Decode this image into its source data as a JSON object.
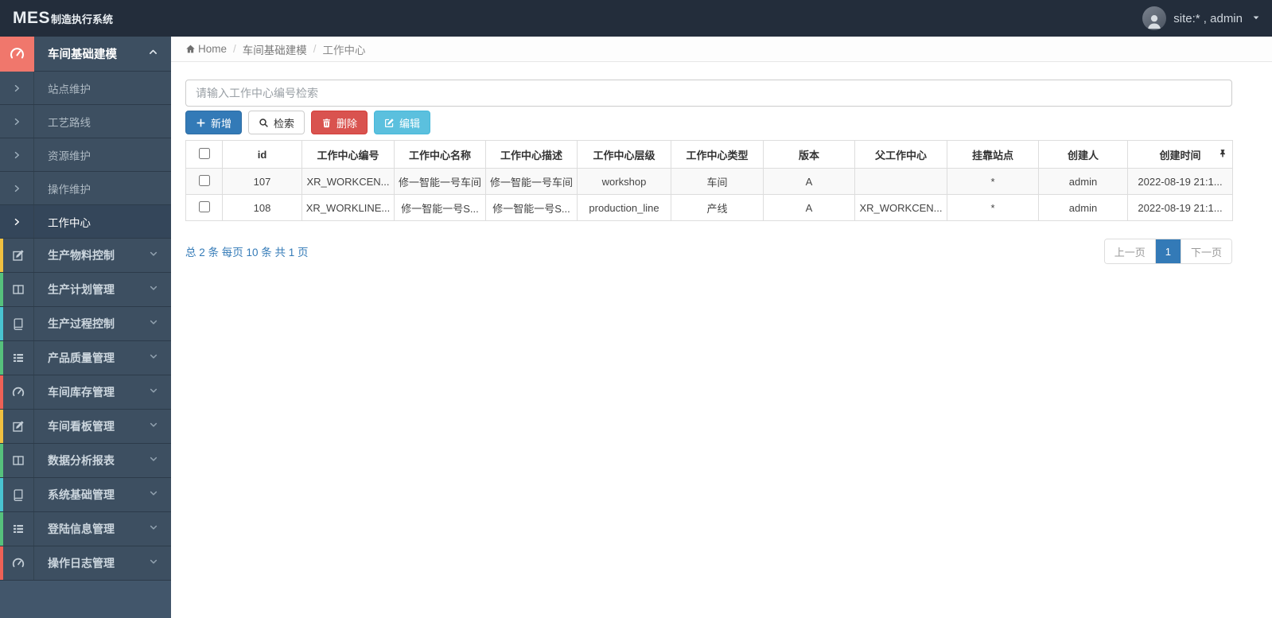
{
  "colors": {
    "topbar_bg": "#232d3b",
    "sidebar_bg": "#42566b",
    "sidebar_item_bg": "#3d4f61",
    "group_icon_bg": "#f0776c",
    "primary_blue": "#337ab7",
    "danger_red": "#d9534f",
    "info_blue": "#5bc0de",
    "accent_yellow": "#f0c040",
    "accent_green": "#56c17c",
    "accent_teal": "#49c3d0",
    "accent_red": "#ee6156"
  },
  "topbar": {
    "logo_main": "MES",
    "logo_suffix": "制造执行系统",
    "user_label": "site:* , admin"
  },
  "breadcrumb": {
    "home": "Home",
    "separator": "/",
    "section": "车间基础建模",
    "current": "工作中心"
  },
  "sidebar": {
    "group_label": "车间基础建模",
    "submenu": [
      {
        "label": "站点维护"
      },
      {
        "label": "工艺路线"
      },
      {
        "label": "资源维护"
      },
      {
        "label": "操作维护"
      },
      {
        "label": "工作中心",
        "active": true
      }
    ],
    "items": [
      {
        "label": "生产物料控制",
        "icon": "pencil-icon",
        "accent": "#f0c040"
      },
      {
        "label": "生产计划管理",
        "icon": "columns-icon",
        "accent": "#56c17c"
      },
      {
        "label": "生产过程控制",
        "icon": "book-icon",
        "accent": "#49c3d0"
      },
      {
        "label": "产品质量管理",
        "icon": "list-icon",
        "accent": "#56c17c"
      },
      {
        "label": "车间库存管理",
        "icon": "gauge-icon",
        "accent": "#ee6156"
      },
      {
        "label": "车间看板管理",
        "icon": "pencil-icon",
        "accent": "#f0c040"
      },
      {
        "label": "数据分析报表",
        "icon": "columns-icon",
        "accent": "#56c17c"
      },
      {
        "label": "系统基础管理",
        "icon": "book-icon",
        "accent": "#49c3d0"
      },
      {
        "label": "登陆信息管理",
        "icon": "list-icon",
        "accent": "#56c17c"
      },
      {
        "label": "操作日志管理",
        "icon": "gauge-icon",
        "accent": "#ee6156"
      }
    ]
  },
  "toolbar": {
    "search_placeholder": "请输入工作中心编号检索",
    "add_label": "新增",
    "search_label": "检索",
    "delete_label": "删除",
    "edit_label": "编辑"
  },
  "table": {
    "columns": [
      "id",
      "工作中心编号",
      "工作中心名称",
      "工作中心描述",
      "工作中心层级",
      "工作中心类型",
      "版本",
      "父工作中心",
      "挂靠站点",
      "创建人",
      "创建时间"
    ],
    "rows": [
      {
        "cells": [
          "107",
          "XR_WORKCEN...",
          "修一智能一号车间",
          "修一智能一号车间",
          "workshop",
          "车间",
          "A",
          "",
          "*",
          "admin",
          "2022-08-19 21:1..."
        ]
      },
      {
        "cells": [
          "108",
          "XR_WORKLINE...",
          "修一智能一号S...",
          "修一智能一号S...",
          "production_line",
          "产线",
          "A",
          "XR_WORKCEN...",
          "*",
          "admin",
          "2022-08-19 21:1..."
        ]
      }
    ]
  },
  "pagination": {
    "summary": "总 2 条 每页 10 条 共 1 页",
    "prev": "上一页",
    "page": "1",
    "next": "下一页"
  }
}
